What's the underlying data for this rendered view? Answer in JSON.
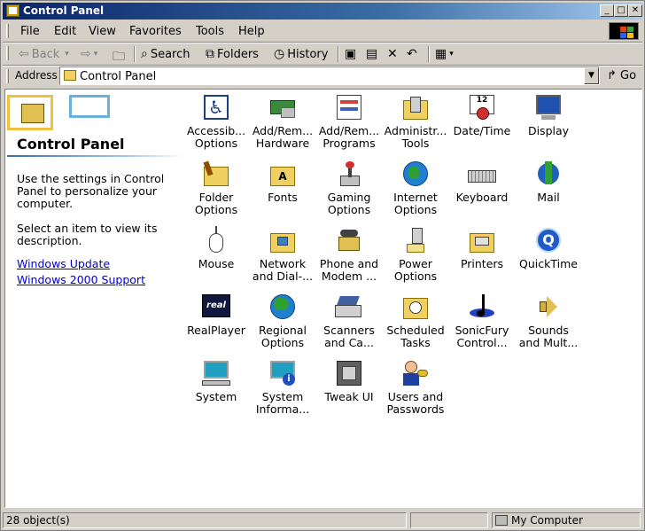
{
  "window": {
    "title": "Control Panel"
  },
  "menu": [
    "File",
    "Edit",
    "View",
    "Favorites",
    "Tools",
    "Help"
  ],
  "toolbar": {
    "back": "Back",
    "search": "Search",
    "folders": "Folders",
    "history": "History",
    "go": "Go"
  },
  "address": {
    "label": "Address",
    "value": "Control Panel"
  },
  "left_pane": {
    "title": "Control Panel",
    "description": "Use the settings in Control Panel to personalize your computer.",
    "hint": "Select an item to view its description.",
    "links": [
      "Windows Update",
      "Windows 2000 Support"
    ]
  },
  "items": [
    {
      "label": "Accessib...\nOptions",
      "icon": "accessibility-icon"
    },
    {
      "label": "Add/Rem...\nHardware",
      "icon": "add-hardware-icon"
    },
    {
      "label": "Add/Rem...\nPrograms",
      "icon": "add-programs-icon"
    },
    {
      "label": "Administr...\nTools",
      "icon": "admin-tools-icon"
    },
    {
      "label": "Date/Time",
      "icon": "calendar-clock-icon"
    },
    {
      "label": "Display",
      "icon": "monitor-icon"
    },
    {
      "label": "Folder\nOptions",
      "icon": "folder-options-icon"
    },
    {
      "label": "Fonts",
      "icon": "fonts-folder-icon"
    },
    {
      "label": "Gaming\nOptions",
      "icon": "joystick-icon"
    },
    {
      "label": "Internet\nOptions",
      "icon": "globe-icon"
    },
    {
      "label": "Keyboard",
      "icon": "keyboard-icon"
    },
    {
      "label": "Mail",
      "icon": "mail-icon"
    },
    {
      "label": "Mouse",
      "icon": "mouse-icon"
    },
    {
      "label": "Network\nand Dial-...",
      "icon": "network-folder-icon"
    },
    {
      "label": "Phone and\nModem ...",
      "icon": "phone-icon"
    },
    {
      "label": "Power\nOptions",
      "icon": "power-plug-icon"
    },
    {
      "label": "Printers",
      "icon": "printer-folder-icon"
    },
    {
      "label": "QuickTime",
      "icon": "quicktime-icon"
    },
    {
      "label": "RealPlayer",
      "icon": "realplayer-icon"
    },
    {
      "label": "Regional\nOptions",
      "icon": "regional-globe-icon"
    },
    {
      "label": "Scanners\nand Ca...",
      "icon": "scanner-icon"
    },
    {
      "label": "Scheduled\nTasks",
      "icon": "scheduled-tasks-icon"
    },
    {
      "label": "SonicFury\nControl...",
      "icon": "sonicfury-icon"
    },
    {
      "label": "Sounds\nand Mult...",
      "icon": "speaker-icon"
    },
    {
      "label": "System",
      "icon": "computer-icon"
    },
    {
      "label": "System\nInforma...",
      "icon": "system-info-icon"
    },
    {
      "label": "Tweak UI",
      "icon": "tweak-ui-icon"
    },
    {
      "label": "Users and\nPasswords",
      "icon": "users-keys-icon"
    }
  ],
  "status": {
    "count": "28 object(s)",
    "zone": "My Computer"
  }
}
